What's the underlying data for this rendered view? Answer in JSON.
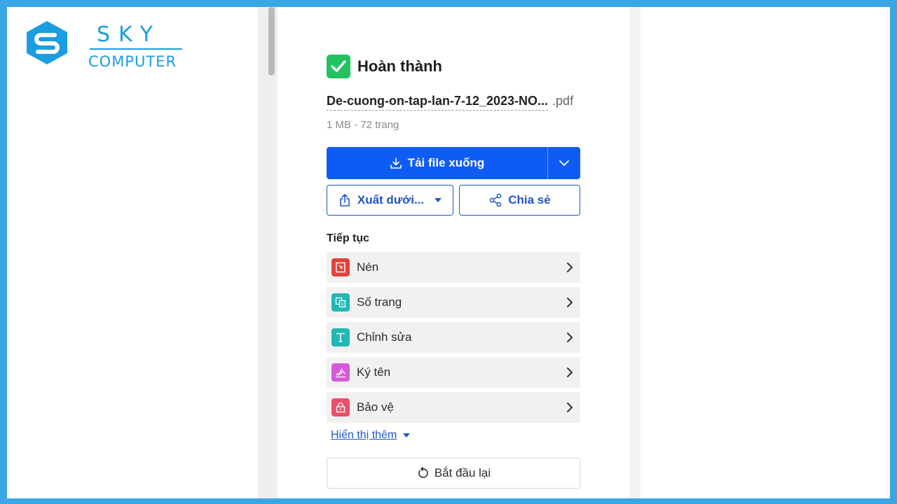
{
  "logo": {
    "brand_top": "SKY",
    "brand_bottom": "COMPUTER"
  },
  "status": {
    "title": "Hoàn thành",
    "icon": "check-icon",
    "color": "#22c35e"
  },
  "file": {
    "name": "De-cuong-on-tap-lan-7-12_2023-NO...",
    "extension": ".pdf",
    "meta": "1 MB - 72 trang"
  },
  "actions": {
    "download_label": "Tải file xuống",
    "export_label": "Xuất dưới...",
    "share_label": "Chia sẻ",
    "primary_color": "#0f5cf5"
  },
  "continue": {
    "title": "Tiếp tục",
    "tools": [
      {
        "label": "Nén",
        "icon": "compress-icon",
        "color": "#e0433b"
      },
      {
        "label": "Số trang",
        "icon": "page-number-icon",
        "color": "#1fb8b4"
      },
      {
        "label": "Chỉnh sửa",
        "icon": "edit-text-icon",
        "color": "#1fb8b4"
      },
      {
        "label": "Ký tên",
        "icon": "sign-icon",
        "color": "#d45ad9"
      },
      {
        "label": "Bảo vệ",
        "icon": "lock-icon",
        "color": "#ec4f69"
      }
    ],
    "show_more": "Hiển thị thêm"
  },
  "restart": {
    "label": "Bắt đầu lại"
  }
}
